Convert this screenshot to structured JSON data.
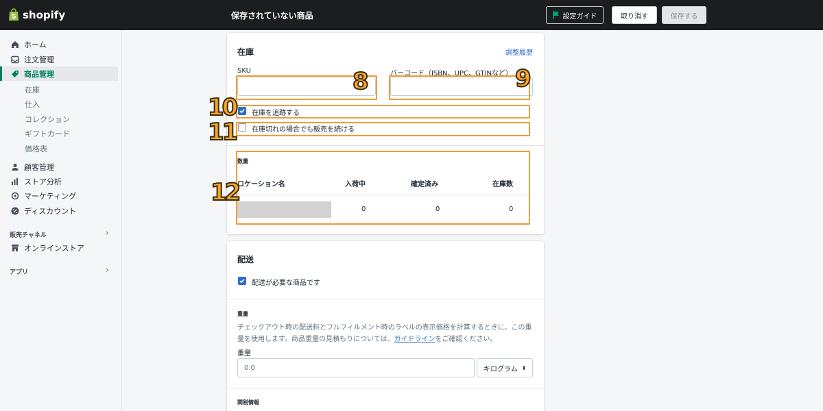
{
  "topbar": {
    "brand": "shopify",
    "title": "保存されていない商品",
    "guide_label": "設定ガイド",
    "discard_label": "取り消す",
    "save_label": "保存する"
  },
  "sidebar": {
    "items": [
      {
        "label": "ホーム",
        "icon": "home-icon"
      },
      {
        "label": "注文管理",
        "icon": "inbox-icon"
      },
      {
        "label": "商品管理",
        "icon": "tag-icon"
      },
      {
        "label": "顧客管理",
        "icon": "person-icon"
      },
      {
        "label": "ストア分析",
        "icon": "bar-chart-icon"
      },
      {
        "label": "マーケティング",
        "icon": "target-icon"
      },
      {
        "label": "ディスカウント",
        "icon": "discount-icon"
      }
    ],
    "sub_items": [
      "在庫",
      "仕入",
      "コレクション",
      "ギフトカード",
      "価格表"
    ],
    "sales_channels_label": "販売チャネル",
    "online_store_label": "オンラインストア",
    "apps_label": "アプリ"
  },
  "inventory": {
    "title": "在庫",
    "history_link": "調整履歴",
    "sku_label": "SKU",
    "sku_value": "",
    "barcode_label": "バーコード（ISBN、UPC、GTINなど）",
    "barcode_value": "",
    "track_label": "在庫を追跡する",
    "track_checked": true,
    "continue_label": "在庫切れの場合でも販売を続ける",
    "continue_checked": false,
    "quantity_head": "数量",
    "columns": [
      "ロケーション名",
      "入荷中",
      "確定済み",
      "在庫数"
    ],
    "row": {
      "incoming": "0",
      "committed": "0",
      "available": "0"
    }
  },
  "annotations": [
    "8",
    "9",
    "10",
    "11",
    "12"
  ],
  "shipping": {
    "title": "配送",
    "required_label": "配送が必要な商品です",
    "required_checked": true,
    "weight_head": "重量",
    "desc_before": "チェックアウト時の配送料とフルフィルメント時のラベルの表示価格を計算するときに、この重量を使用します。商品重量の見積もりについては、",
    "desc_link": "ガイドライン",
    "desc_after": "をご確認ください。",
    "weight_label": "重量",
    "weight_value": "0.0",
    "unit": "キログラム",
    "customs_head": "関税情報"
  },
  "colors": {
    "accent": "#008060",
    "primary": "#2c6ecb",
    "annotation": "#f29c38",
    "topbar": "#1c1d1f"
  }
}
